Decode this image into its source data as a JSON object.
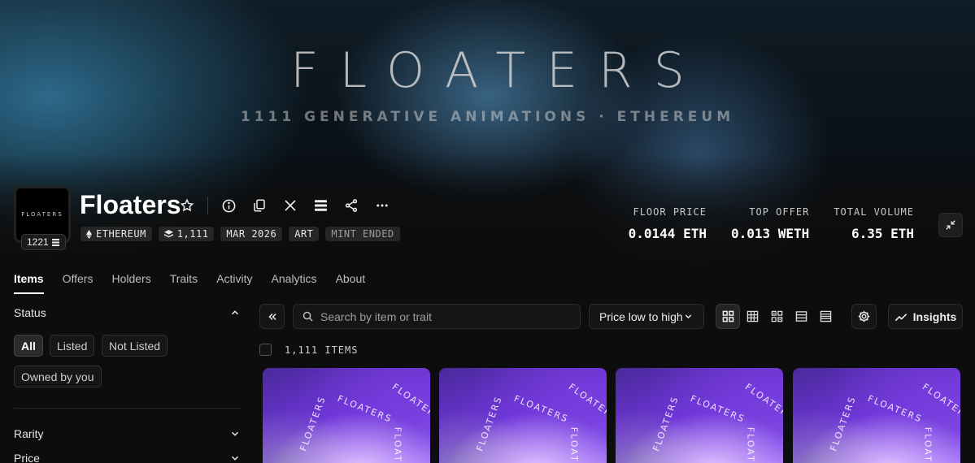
{
  "banner": {
    "title": "FLOATERS",
    "subtitle": "1111 GENERATIVE ANIMATIONS · ETHEREUM"
  },
  "collection": {
    "name": "Floaters",
    "avatar_label": "FLOATERS",
    "avatar_badge": "1221",
    "tags": [
      "ETHEREUM",
      "1,111",
      "MAR 2026",
      "ART",
      "MINT ENDED"
    ]
  },
  "stats": [
    {
      "label": "FLOOR PRICE",
      "value": "0.0144 ETH"
    },
    {
      "label": "TOP OFFER",
      "value": "0.013 WETH"
    },
    {
      "label": "TOTAL VOLUME",
      "value": "6.35 ETH"
    }
  ],
  "tabs": [
    "Items",
    "Offers",
    "Holders",
    "Traits",
    "Activity",
    "Analytics",
    "About"
  ],
  "sidebar": {
    "status_title": "Status",
    "status_filters": [
      "All",
      "Listed",
      "Not Listed",
      "Owned by you"
    ],
    "rarity_title": "Rarity",
    "price_title": "Price"
  },
  "toolbar": {
    "search_placeholder": "Search by item or trait",
    "sort_label": "Price low to high",
    "insights_label": "Insights"
  },
  "items": {
    "count_label": "1,111 ITEMS",
    "card_text": "FLOATERS"
  },
  "colors": {
    "background": "#0d0d0d",
    "card_purple": "#6d35d8"
  }
}
